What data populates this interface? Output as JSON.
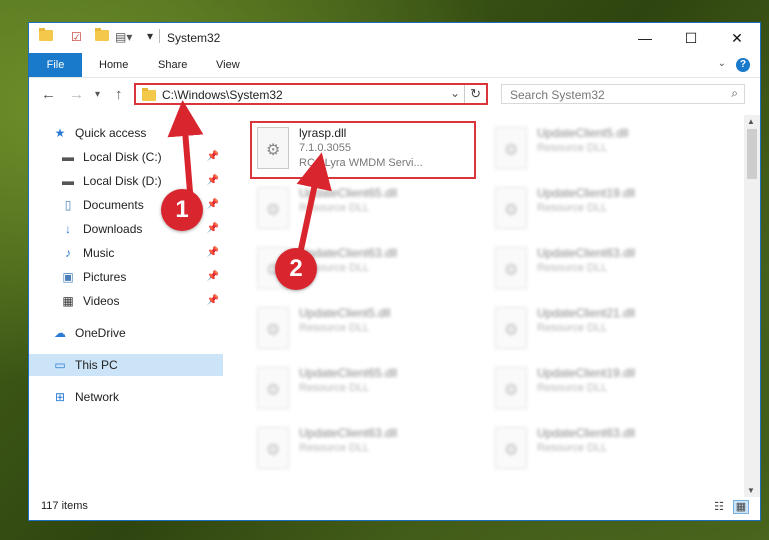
{
  "window": {
    "title": "System32",
    "controls": {
      "minimize": "—",
      "maximize": "☐",
      "close": "✕"
    }
  },
  "ribbon": {
    "tabs": [
      {
        "label": "File"
      },
      {
        "label": "Home"
      },
      {
        "label": "Share"
      },
      {
        "label": "View"
      }
    ],
    "help": "?"
  },
  "navbar": {
    "address": "C:\\Windows\\System32",
    "search_placeholder": "Search System32"
  },
  "navpane": {
    "items": [
      {
        "label": "Quick access",
        "icon": "star-icon"
      },
      {
        "label": "Local Disk (C:)",
        "icon": "drive-icon",
        "pinned": true
      },
      {
        "label": "Local Disk (D:)",
        "icon": "drive-icon",
        "pinned": true
      },
      {
        "label": "Documents",
        "icon": "documents-icon",
        "pinned": true
      },
      {
        "label": "Downloads",
        "icon": "downloads-icon",
        "pinned": true
      },
      {
        "label": "Music",
        "icon": "music-icon",
        "pinned": true
      },
      {
        "label": "Pictures",
        "icon": "pictures-icon",
        "pinned": true
      },
      {
        "label": "Videos",
        "icon": "videos-icon",
        "pinned": true
      },
      {
        "label": "OneDrive",
        "icon": "cloud-icon"
      },
      {
        "label": "This PC",
        "icon": "computer-icon",
        "selected": true
      },
      {
        "label": "Network",
        "icon": "network-icon"
      }
    ]
  },
  "files": {
    "highlighted": {
      "name": "lyrasp.dll",
      "version": "7.1.0.3055",
      "description": "RCA Lyra WMDM Servi..."
    },
    "blurred": [
      {
        "name": "UpdateClient5.dll",
        "type": "Resource DLL"
      },
      {
        "name": "UpdateClient65.dll",
        "type": "Resource DLL"
      },
      {
        "name": "UpdateClient19.dll",
        "type": "Resource DLL"
      },
      {
        "name": "UpdateClient63.dll",
        "type": "Resource DLL"
      },
      {
        "name": "UpdateClient63.dll",
        "type": "Resource DLL"
      },
      {
        "name": "UpdateClient5.dll",
        "type": "Resource DLL"
      },
      {
        "name": "UpdateClient21.dll",
        "type": "Resource DLL"
      },
      {
        "name": "UpdateClient65.dll",
        "type": "Resource DLL"
      },
      {
        "name": "UpdateClient19.dll",
        "type": "Resource DLL"
      },
      {
        "name": "UpdateClient63.dll",
        "type": "Resource DLL"
      },
      {
        "name": "UpdateClient63.dll",
        "type": "Resource DLL"
      }
    ]
  },
  "status": {
    "item_count": "117 items"
  },
  "annotations": {
    "badge1": "1",
    "badge2": "2",
    "color": "#d9262e"
  }
}
